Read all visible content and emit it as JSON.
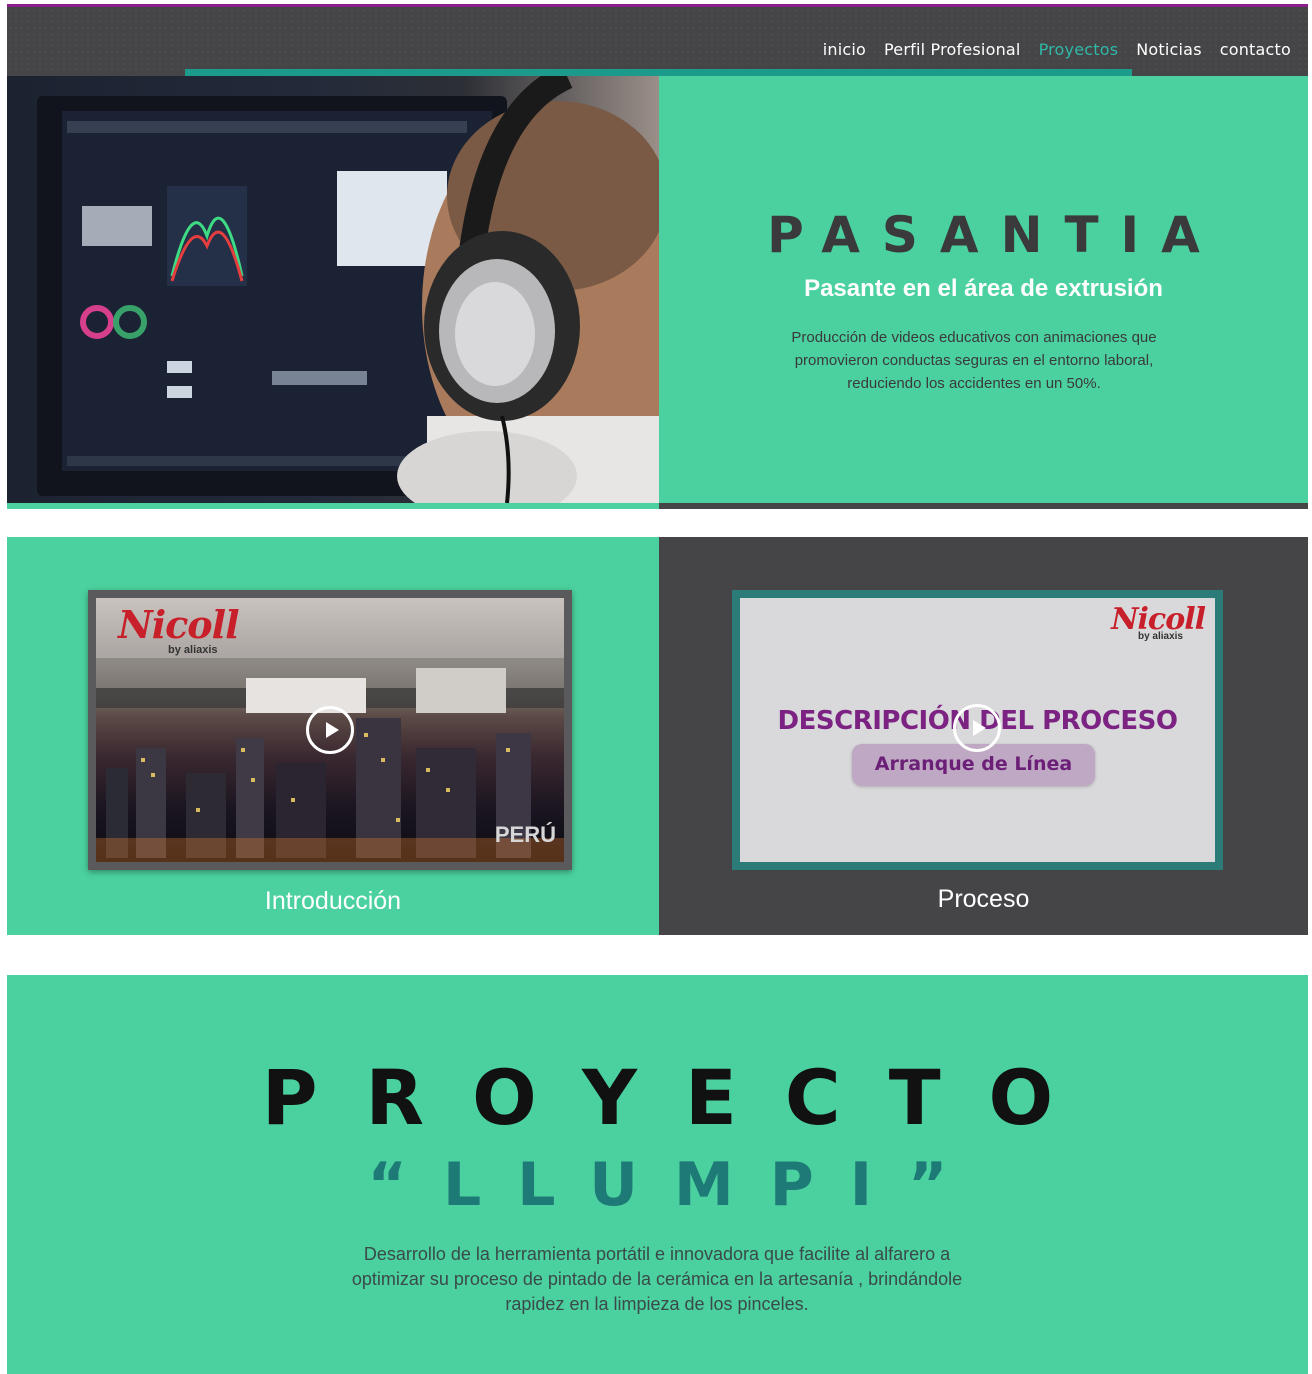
{
  "nav": {
    "items": [
      {
        "label": "inicio",
        "active": false
      },
      {
        "label": "Perfil Profesional",
        "active": false
      },
      {
        "label": "Proyectos",
        "active": true
      },
      {
        "label": "Noticias",
        "active": false
      },
      {
        "label": "contacto",
        "active": false
      }
    ]
  },
  "pasantia": {
    "title": "PASANTIA",
    "subtitle": "Pasante en el área de extrusión",
    "description": "Producción de videos educativos con animaciones que promovieron conductas seguras en el entorno laboral, reduciendo los accidentes en un 50%."
  },
  "videos": [
    {
      "caption": "Introducción",
      "logo": "Nicoll",
      "logo_sub": "by aliaxis",
      "overlay_text": "PERÚ"
    },
    {
      "caption": "Proceso",
      "logo": "Nicoll",
      "logo_sub": "by aliaxis",
      "slide_title": "DESCRIPCIÓN DEL PROCESO",
      "slide_pill": "Arranque de Línea"
    }
  ],
  "llumpi": {
    "title": "PROYECTO",
    "subtitle": "“LLUMPI”",
    "description": "Desarrollo de la herramienta portátil e innovadora que facilite al alfarero a optimizar su proceso de pintado de la cerámica en la artesanía , brindándole rapidez en la limpieza de los pinceles."
  },
  "colors": {
    "mint": "#4bd19f",
    "dark": "#454446",
    "teal": "#1c9a8c",
    "active_nav": "#2fb8a8",
    "brand_red": "#c7202a",
    "purple": "#7b2283"
  }
}
